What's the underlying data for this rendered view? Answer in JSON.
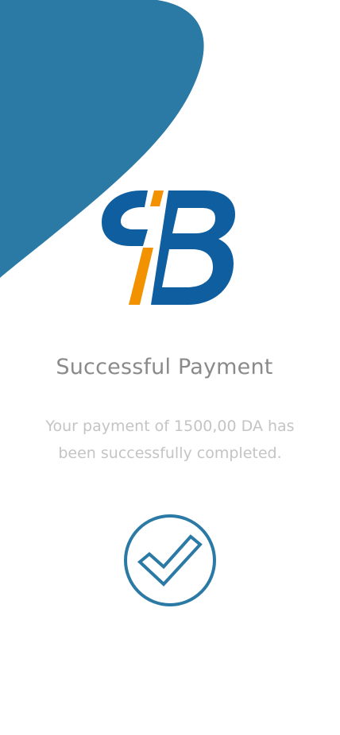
{
  "colors": {
    "brand_blue": "#2b7aa5",
    "logo_blue": "#0f5fa0",
    "logo_orange": "#f39200",
    "title_gray": "#8a8a8a",
    "message_gray": "#c4c4c4",
    "background": "#ffffff"
  },
  "logo": {
    "icon": "cib-logo"
  },
  "payment": {
    "title": "Successful Payment",
    "message": "Your payment of 1500,00 DA has been successfully completed."
  },
  "status": {
    "icon": "check-circle-icon"
  }
}
